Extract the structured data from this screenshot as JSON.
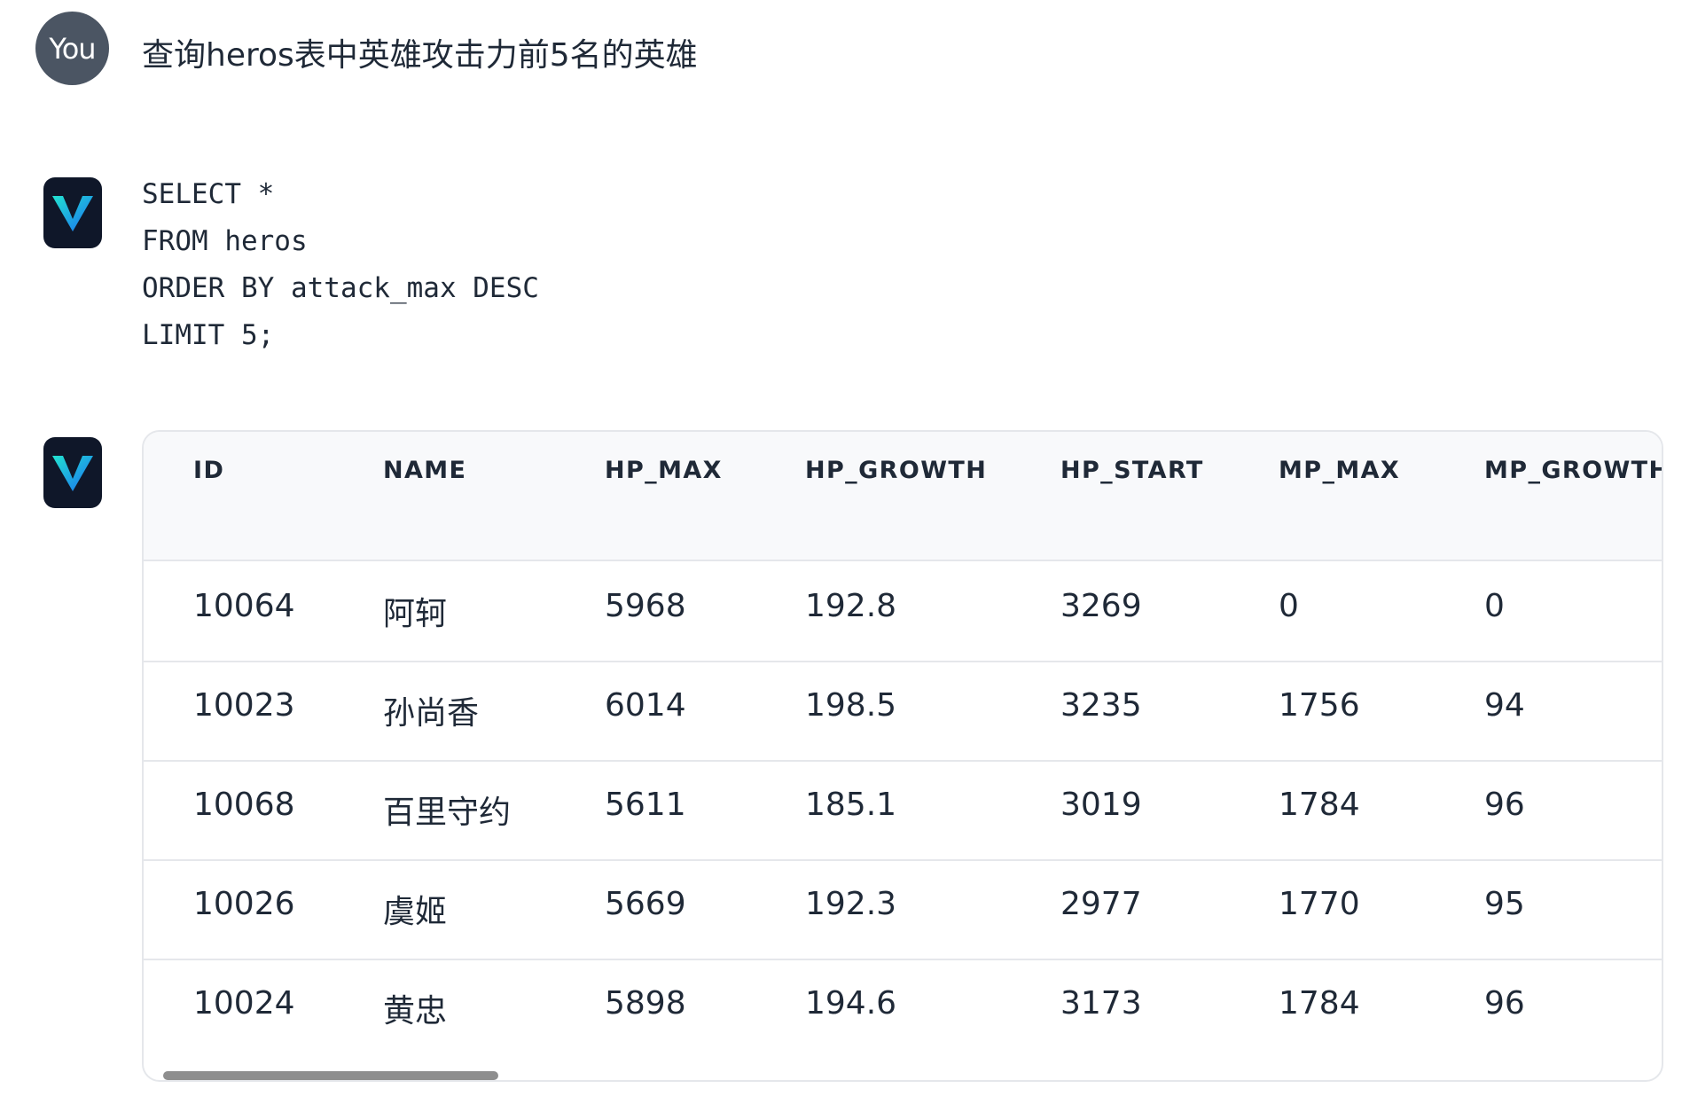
{
  "user_message": {
    "avatar_label": "You",
    "text": "查询heros表中英雄攻击力前5名的英雄"
  },
  "bot_avatar_icon": "chevron-v-logo-icon",
  "sql_lines": [
    "SELECT *",
    "FROM heros",
    "ORDER BY attack_max DESC",
    "LIMIT 5;"
  ],
  "result_table": {
    "columns": [
      "ID",
      "NAME",
      "HP_MAX",
      "HP_GROWTH",
      "HP_START",
      "MP_MAX",
      "MP_GROWTH"
    ],
    "rows": [
      [
        "10064",
        "阿轲",
        "5968",
        "192.8",
        "3269",
        "0",
        "0"
      ],
      [
        "10023",
        "孙尚香",
        "6014",
        "198.5",
        "3235",
        "1756",
        "94"
      ],
      [
        "10068",
        "百里守约",
        "5611",
        "185.1",
        "3019",
        "1784",
        "96"
      ],
      [
        "10026",
        "虞姬",
        "5669",
        "192.3",
        "2977",
        "1770",
        "95"
      ],
      [
        "10024",
        "黄忠",
        "5898",
        "194.6",
        "3173",
        "1784",
        "96"
      ]
    ]
  },
  "colors": {
    "user_avatar_bg": "#4b5563",
    "bot_avatar_bg": "#0f1729",
    "logo_gradient_start": "#22e3d0",
    "logo_gradient_end": "#1a6ff2",
    "table_header_bg": "#f8f9fb",
    "border": "#e5e7eb"
  }
}
